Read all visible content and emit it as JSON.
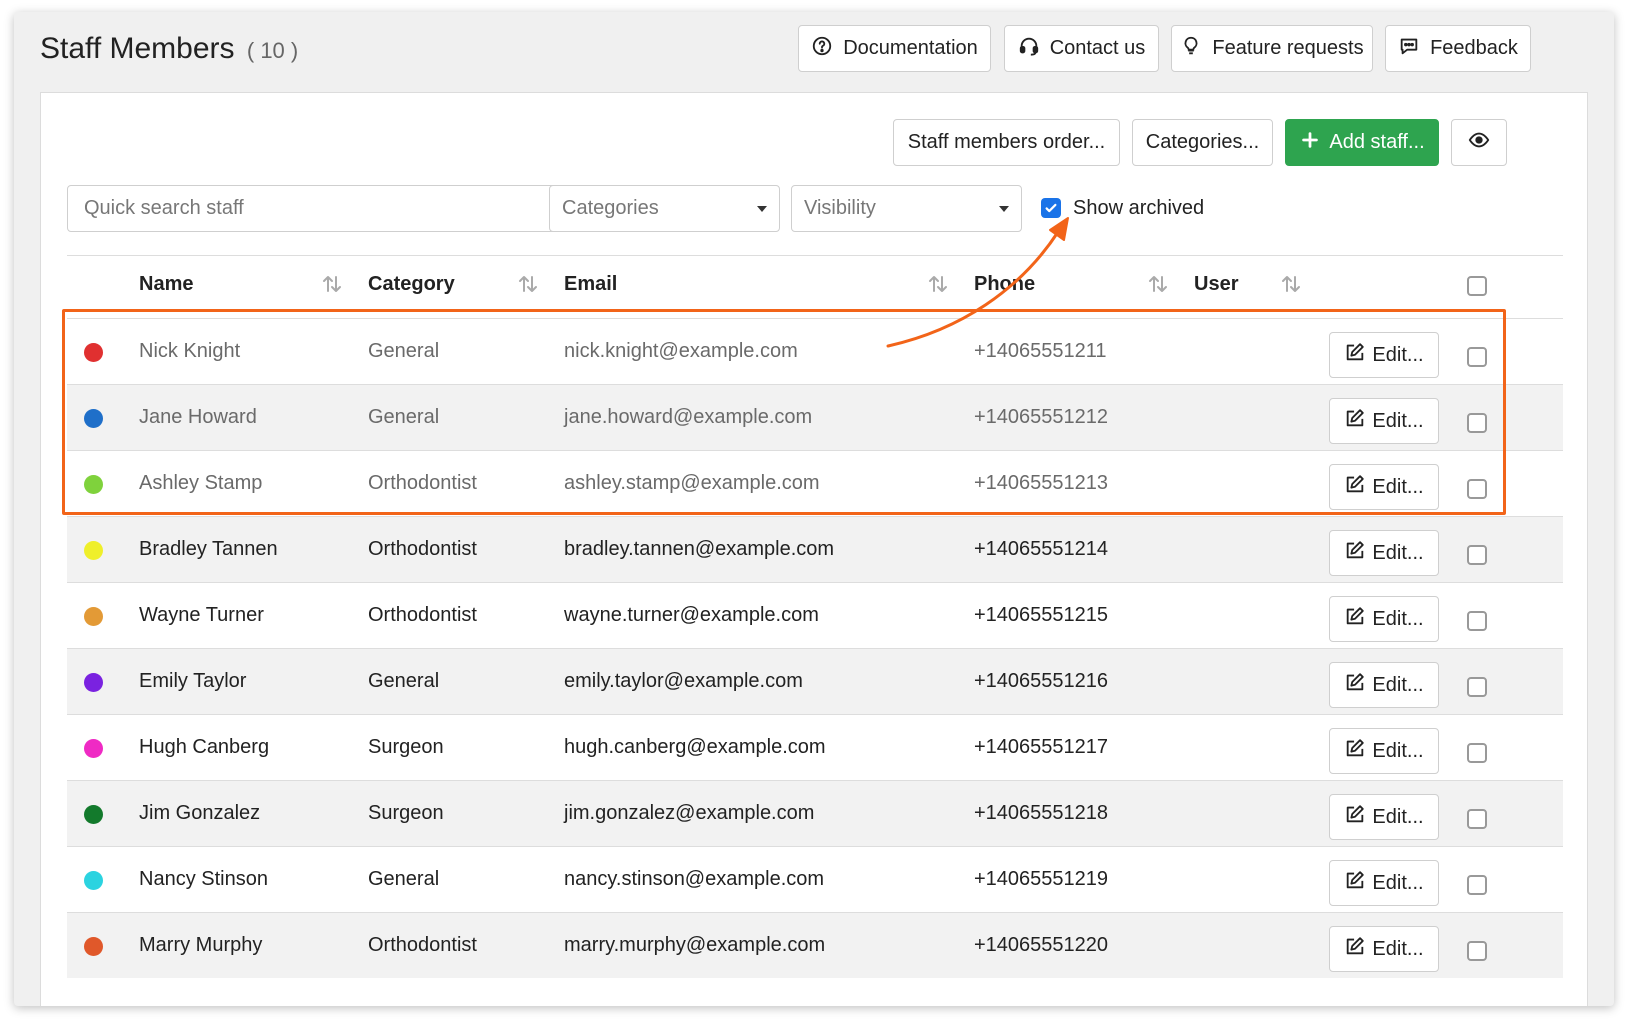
{
  "header": {
    "title": "Staff Members",
    "count": "( 10 )",
    "buttons": {
      "documentation": "Documentation",
      "contact": "Contact us",
      "feature": "Feature requests",
      "feedback": "Feedback"
    }
  },
  "toolbar": {
    "order": "Staff members order...",
    "categories": "Categories...",
    "add": "Add staff..."
  },
  "filters": {
    "search_placeholder": "Quick search staff",
    "categories": "Categories",
    "visibility": "Visibility",
    "show_archived": "Show archived",
    "show_archived_checked": true
  },
  "table": {
    "headers": {
      "name": "Name",
      "category": "Category",
      "email": "Email",
      "phone": "Phone",
      "user": "User"
    },
    "edit_label": "Edit...",
    "rows": [
      {
        "name": "Nick Knight",
        "category": "General",
        "email": "nick.knight@example.com",
        "phone": "+14065551211",
        "user": "",
        "color": "#e03030",
        "archived": true
      },
      {
        "name": "Jane Howard",
        "category": "General",
        "email": "jane.howard@example.com",
        "phone": "+14065551212",
        "user": "",
        "color": "#1f6fc9",
        "archived": true
      },
      {
        "name": "Ashley Stamp",
        "category": "Orthodontist",
        "email": "ashley.stamp@example.com",
        "phone": "+14065551213",
        "user": "",
        "color": "#7fd23c",
        "archived": true
      },
      {
        "name": "Bradley Tannen",
        "category": "Orthodontist",
        "email": "bradley.tannen@example.com",
        "phone": "+14065551214",
        "user": "",
        "color": "#efef2a",
        "archived": false
      },
      {
        "name": "Wayne Turner",
        "category": "Orthodontist",
        "email": "wayne.turner@example.com",
        "phone": "+14065551215",
        "user": "",
        "color": "#e39a36",
        "archived": false
      },
      {
        "name": "Emily Taylor",
        "category": "General",
        "email": "emily.taylor@example.com",
        "phone": "+14065551216",
        "user": "",
        "color": "#7a22e0",
        "archived": false
      },
      {
        "name": "Hugh Canberg",
        "category": "Surgeon",
        "email": "hugh.canberg@example.com",
        "phone": "+14065551217",
        "user": "",
        "color": "#ef2ac4",
        "archived": false
      },
      {
        "name": "Jim Gonzalez",
        "category": "Surgeon",
        "email": "jim.gonzalez@example.com",
        "phone": "+14065551218",
        "user": "",
        "color": "#137a2c",
        "archived": false
      },
      {
        "name": "Nancy Stinson",
        "category": "General",
        "email": "nancy.stinson@example.com",
        "phone": "+14065551219",
        "user": "",
        "color": "#2bd3e0",
        "archived": false
      },
      {
        "name": "Marry Murphy",
        "category": "Orthodontist",
        "email": "marry.murphy@example.com",
        "phone": "+14065551220",
        "user": "",
        "color": "#e0582a",
        "archived": false
      }
    ]
  },
  "colors": {
    "accent": "#2ea44f",
    "highlight": "#f26419",
    "checkbox": "#1a73e8"
  },
  "icons": {
    "documentation": "question-circle-icon",
    "contact": "headset-icon",
    "feature": "lightbulb-icon",
    "feedback": "chat-bubble-icon",
    "add": "plus-icon",
    "visibility": "eye-icon",
    "edit": "edit-icon",
    "sort": "sort-icon"
  }
}
